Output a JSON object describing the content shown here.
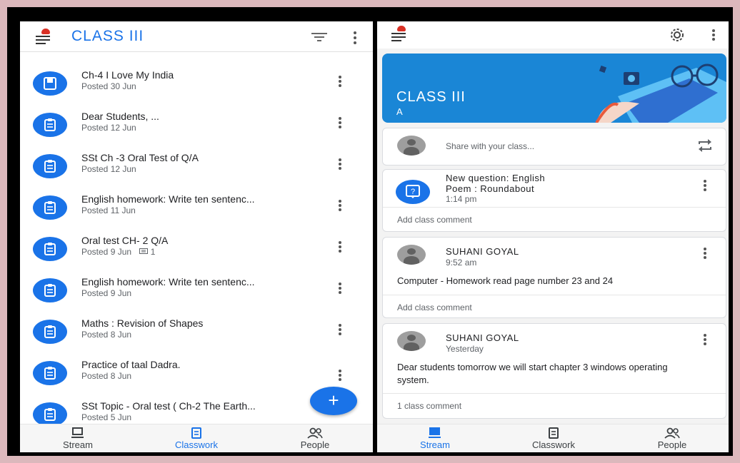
{
  "left": {
    "class_name": "CLASS III",
    "items": [
      {
        "title": "Ch-4 I Love My India",
        "sub": "Posted 30 Jun",
        "comments": "",
        "icon": "material-icon"
      },
      {
        "title": "Dear Students, ...",
        "sub": "Posted 12 Jun",
        "comments": "",
        "icon": "assignment-icon"
      },
      {
        "title": "SSt  Ch -3 Oral Test of Q/A",
        "sub": "Posted 12 Jun",
        "comments": "",
        "icon": "assignment-icon"
      },
      {
        "title": "English homework: Write ten sentenc...",
        "sub": "Posted 11 Jun",
        "comments": "",
        "icon": "assignment-icon"
      },
      {
        "title": "Oral test CH- 2 Q/A",
        "sub": "Posted 9 Jun",
        "comments": "1",
        "icon": "assignment-icon"
      },
      {
        "title": "English homework: Write ten sentenc...",
        "sub": "Posted 9 Jun",
        "comments": "",
        "icon": "assignment-icon"
      },
      {
        "title": "Maths : Revision of Shapes",
        "sub": "Posted 8 Jun",
        "comments": "",
        "icon": "assignment-icon"
      },
      {
        "title": "Practice of taal Dadra.",
        "sub": "Posted 8 Jun",
        "comments": "",
        "icon": "assignment-icon"
      },
      {
        "title": "SSt  Topic - Oral test ( Ch-2 The Earth...",
        "sub": "Posted 5 Jun",
        "comments": "",
        "icon": "assignment-icon"
      }
    ],
    "fab_label": "+",
    "nav": {
      "stream": "Stream",
      "classwork": "Classwork",
      "people": "People",
      "active": "classwork"
    }
  },
  "right": {
    "banner_title": "CLASS III",
    "banner_section": "A",
    "share_placeholder": "Share with your class...",
    "question_card": {
      "line1": "New question: English",
      "line2": "Poem : Roundabout",
      "time": "1:14 pm",
      "comment_label": "Add class comment"
    },
    "post1": {
      "author": "SUHANI GOYAL",
      "time": "9:52 am",
      "body": "Computer - Homework read page number 23 and 24",
      "comment_label": "Add class comment"
    },
    "post2": {
      "author": "SUHANI GOYAL",
      "time": "Yesterday",
      "body": "Dear students tomorrow we will start chapter 3 windows operating system.",
      "comment_label": "1 class comment"
    },
    "nav": {
      "stream": "Stream",
      "classwork": "Classwork",
      "people": "People",
      "active": "stream"
    }
  },
  "colors": {
    "accent": "#1a73e8",
    "banner": "#1a86d6",
    "frame": "#dcb8bc"
  }
}
